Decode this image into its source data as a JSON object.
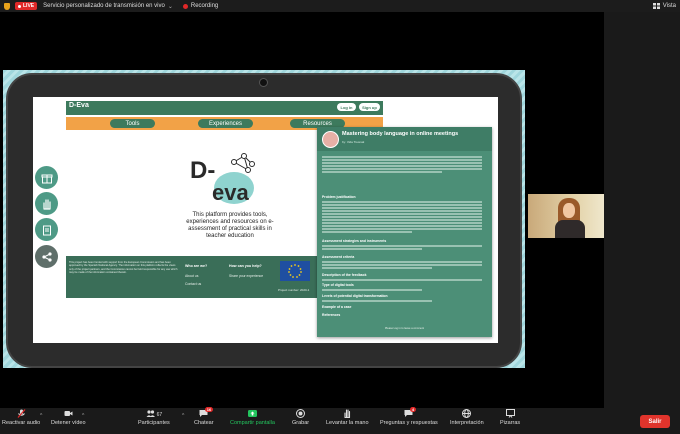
{
  "topbar": {
    "live_label": "LIVE",
    "stream_title": "Servicio personalizado de transmisión en vivo",
    "recording_label": "Recording",
    "view_label": "Vista"
  },
  "site": {
    "logo_small": "D-Eva",
    "login": "Log in",
    "signup": "Sign up",
    "nav": [
      "Tools",
      "Experiences",
      "Resources"
    ],
    "big_logo_top": "D-",
    "big_logo_bottom": "eva",
    "tagline": "This platform provides tools, experiences and resources on e-assessment of practical skills in teacher education",
    "footer": {
      "disclaimer": "This project has been funded with support from the European Commission and has been approved by the Spanish National Agency. The information on this platform reflects the views only of the project partners, and the Commission cannot be held responsible for any use which may be made of the information contained therein.",
      "who_heading": "Who are we?",
      "about": "About us",
      "contact": "Contact us",
      "help_heading": "How can you help?",
      "share": "Share your experience",
      "project_number": "Project number: 2020-1"
    }
  },
  "panel": {
    "title": "Mastering body language in online meetings",
    "author": "by: Vida Tresnak",
    "sections": [
      "Problem justification",
      "Assessment strategies and instruments",
      "Assessment criteria",
      "Description of the feedback",
      "Type of digital tools",
      "Levels of potential digital transformation",
      "Example of a case",
      "References"
    ],
    "footer": "Please Log in to leave a comment"
  },
  "toolbar": {
    "items": [
      {
        "label": "Reactivar audio",
        "icon": "mic-muted-icon"
      },
      {
        "label": "Detener vídeo",
        "icon": "video-icon"
      },
      {
        "label": "Participantes",
        "icon": "participants-icon",
        "count": "67"
      },
      {
        "label": "Chatear",
        "icon": "chat-icon",
        "badge": "16"
      },
      {
        "label": "Compartir pantalla",
        "icon": "share-screen-icon"
      },
      {
        "label": "Grabar",
        "icon": "record-icon"
      },
      {
        "label": "Levantar la mano",
        "icon": "raise-hand-icon"
      },
      {
        "label": "Preguntas y respuestas",
        "icon": "qa-icon",
        "badge": "4"
      },
      {
        "label": "Interpretación",
        "icon": "globe-icon"
      },
      {
        "label": "Pizarras",
        "icon": "whiteboard-icon"
      }
    ],
    "leave": "Salir"
  },
  "colors": {
    "brand_green": "#3d7a5d",
    "nav_orange": "#f2a247",
    "leave_red": "#e0342c",
    "share_green": "#23c55e"
  }
}
